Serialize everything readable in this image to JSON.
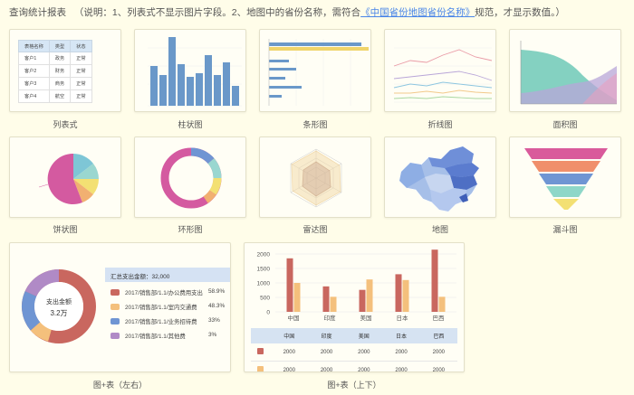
{
  "header": {
    "title": "查询统计报表",
    "note_prefix": "（说明：1、列表式不显示图片字段。2、地图中的省份名称，需符合",
    "link": "《中国省份地图省份名称》",
    "note_suffix": "规范，才显示数值。）"
  },
  "thumbs": [
    {
      "caption": "列表式"
    },
    {
      "caption": "柱状图"
    },
    {
      "caption": "条形图"
    },
    {
      "caption": "折线图"
    },
    {
      "caption": "面积图"
    },
    {
      "caption": "饼状图"
    },
    {
      "caption": "环形图"
    },
    {
      "caption": "雷达图"
    },
    {
      "caption": "地图"
    },
    {
      "caption": "漏斗图"
    }
  ],
  "list_table": {
    "headers": [
      "表格名称",
      "类型",
      "状态"
    ],
    "rows": [
      [
        "客户1",
        "政务",
        "正常"
      ],
      [
        "客户2",
        "财务",
        "正常"
      ],
      [
        "客户3",
        "商务",
        "正常"
      ],
      [
        "客户4",
        "航空",
        "正常"
      ]
    ]
  },
  "combo_left": {
    "caption": "图+表（左右）",
    "center_label": "支出金额",
    "center_value": "3.2万",
    "summary": "汇总支出金额：32,000",
    "colors": [
      "#c9675f",
      "#f4c07c",
      "#6f95d3",
      "#b08ac6"
    ],
    "legend": [
      {
        "label": "2017/销售部/1.1/办公费用支出",
        "pct": "58.9%"
      },
      {
        "label": "2017/销售部/1.1/室内交通费",
        "pct": "48.3%"
      },
      {
        "label": "2017/销售部/1.1/业务招待费",
        "pct": "33%"
      },
      {
        "label": "2017/销售部/1.1/其他费",
        "pct": "3%"
      }
    ]
  },
  "combo_bottom": {
    "caption": "图+表（上下）",
    "colors": [
      "#c9675f",
      "#f4c07c"
    ],
    "table_values": [
      [
        "2000",
        "2000",
        "2000",
        "2000",
        "2000"
      ],
      [
        "2000",
        "2000",
        "2000",
        "2000",
        "2000"
      ]
    ]
  },
  "chart_data": {
    "type": "bar",
    "title": "",
    "categories": [
      "中国",
      "印度",
      "美国",
      "日本",
      "巴西"
    ],
    "series": [
      {
        "values": [
          1850,
          880,
          760,
          1300,
          2150
        ]
      },
      {
        "values": [
          1000,
          520,
          1120,
          1100,
          520
        ]
      }
    ],
    "ylim": [
      0,
      2000
    ],
    "yticks": [
      "2000",
      "1500",
      "1000",
      "500",
      "0"
    ],
    "grid": true
  }
}
